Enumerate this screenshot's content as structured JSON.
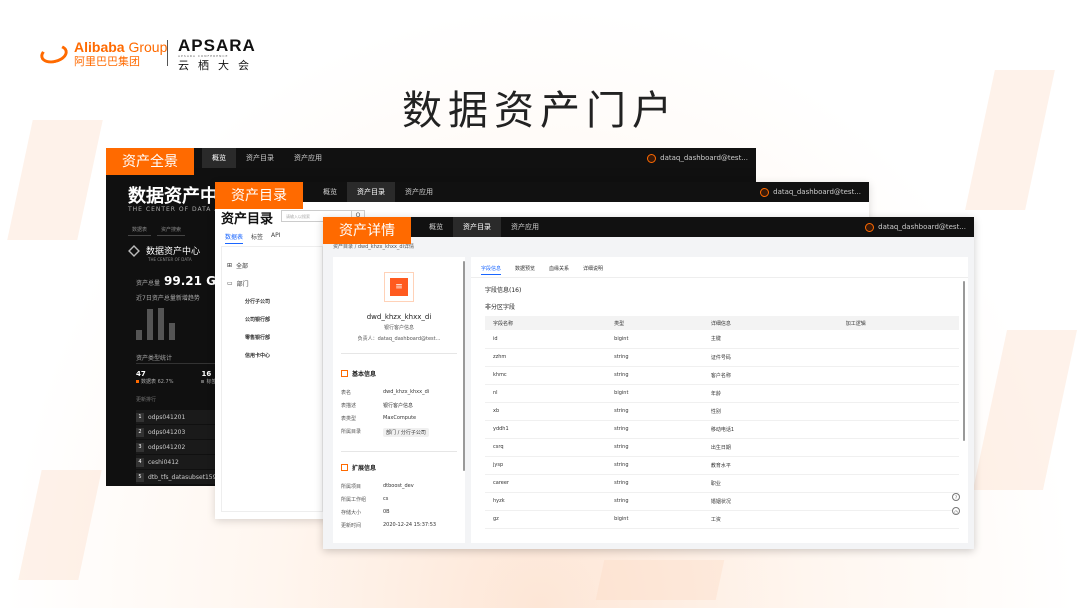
{
  "brand": {
    "alibaba_en": "Alibaba",
    "alibaba_group": "Group",
    "alibaba_cn": "阿里巴巴集团",
    "apsara_en": "APSARA",
    "apsara_sub": "APSARA CONFERENCE",
    "apsara_cn": "云栖大会"
  },
  "slide_title": "数据资产门户",
  "labels": {
    "overview": "资产全景",
    "catalog": "资产目录",
    "detail": "资产详情"
  },
  "nav": {
    "items": [
      "概览",
      "资产目录",
      "资产应用"
    ],
    "user": "dataq_dashboard@test..."
  },
  "overview": {
    "title": "数据资产中心",
    "subtitle": "THE CENTER OF DATA ASSETS",
    "search_left": "数据表",
    "search_right": "资产搜索",
    "card_title": "数据资产中心",
    "card_sub": "THE CENTER OF DATA",
    "total_label": "资产总量",
    "total_value": "99.21 GB",
    "trend_label": "近7日资产总量新增趋势",
    "trend_values": [
      0.3,
      0.9,
      0.95,
      0.5
    ],
    "stat_title": "资产类型统计",
    "stats": [
      {
        "value": "47",
        "label": "数据表 62.7%"
      },
      {
        "value": "16",
        "label": "标签"
      }
    ],
    "recent_label": "更新排行",
    "recent": [
      {
        "rank": "1",
        "name": "odps041201"
      },
      {
        "rank": "2",
        "name": "odps041203"
      },
      {
        "rank": "3",
        "name": "odps041202"
      },
      {
        "rank": "4",
        "name": "ceshi0412"
      },
      {
        "rank": "5",
        "name": "dtb_tfs_datasubset15971"
      }
    ]
  },
  "catalog": {
    "title": "资产目录",
    "search_placeholder": "请输入以搜索",
    "search_btn": "Q",
    "tabs": [
      "数据表",
      "标签",
      "API"
    ],
    "tree": {
      "all": "全部",
      "dept": "部门",
      "children": [
        "分行子公司",
        "公司银行部",
        "零售银行部",
        "信用卡中心"
      ]
    }
  },
  "detail": {
    "breadcrumb": "资产目录 / dwd_khzx_khxx_di详情",
    "table_name": "dwd_khzx_khxx_di",
    "table_desc": "银行客户信息",
    "owner": "负责人：dataq_dashboard@test...",
    "basic_title": "基本信息",
    "basic": [
      {
        "k": "表名",
        "v": "dwd_khzx_khxx_di"
      },
      {
        "k": "表描述",
        "v": "银行客户信息"
      },
      {
        "k": "表类型",
        "v": "MaxCompute"
      },
      {
        "k": "所属目录",
        "v": "部门 / 分行子公司"
      }
    ],
    "ext_title": "扩展信息",
    "ext": [
      {
        "k": "所属项目",
        "v": "dtboost_dev"
      },
      {
        "k": "所属工作组",
        "v": "cs"
      },
      {
        "k": "存储大小",
        "v": "0B"
      },
      {
        "k": "更新时间",
        "v": "2020-12-24 15:37:53"
      }
    ],
    "tabs": [
      "字段信息",
      "数据预览",
      "血缘关系",
      "详细说明"
    ],
    "field_count": "字段信息(16)",
    "non_partition": "非分区字段",
    "columns": [
      "字段名称",
      "类型",
      "详细信息",
      "加工逻辑"
    ],
    "rows": [
      [
        "id",
        "bigint",
        "主键",
        ""
      ],
      [
        "zzhm",
        "string",
        "证件号码",
        ""
      ],
      [
        "khmc",
        "string",
        "客户名称",
        ""
      ],
      [
        "nl",
        "bigint",
        "年龄",
        ""
      ],
      [
        "xb",
        "string",
        "性别",
        ""
      ],
      [
        "yddh1",
        "string",
        "移动电话1",
        ""
      ],
      [
        "csrq",
        "string",
        "出生日期",
        ""
      ],
      [
        "jysp",
        "string",
        "教育水平",
        ""
      ],
      [
        "career",
        "string",
        "职业",
        ""
      ],
      [
        "hyzk",
        "string",
        "婚姻状况",
        ""
      ],
      [
        "gz",
        "bigint",
        "工资",
        ""
      ]
    ]
  },
  "colors": {
    "accent": "#ff6a00",
    "link": "#1a66ff",
    "dark": "#101010"
  }
}
